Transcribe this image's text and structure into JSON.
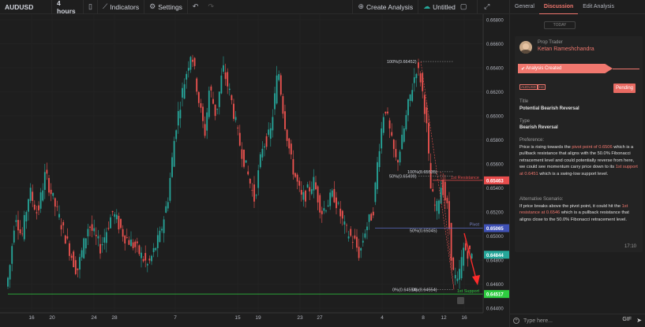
{
  "toolbar": {
    "symbol": "AUDUSD",
    "interval": "4 hours",
    "indicators": "Indicators",
    "settings": "Settings",
    "create_analysis": "Create Analysis",
    "untitled": "Untitled"
  },
  "chart_data": {
    "type": "candlestick",
    "price_axis": [
      "0.66800",
      "0.66600",
      "0.66400",
      "0.66200",
      "0.66000",
      "0.65800",
      "0.65600",
      "0.65400",
      "0.65200",
      "0.65000",
      "0.64800",
      "0.64600",
      "0.64400"
    ],
    "time_axis": [
      "16",
      "20",
      "24",
      "28",
      "7",
      "15",
      "19",
      "23",
      "27",
      "4",
      "8",
      "12",
      "16"
    ],
    "price_labels": [
      {
        "text": "0.65463",
        "color": "#e84c4c"
      },
      {
        "text": "0.65065",
        "color": "#3f51b5"
      },
      {
        "text": "0.64844",
        "color": "#26a69a"
      },
      {
        "text": "0.64517",
        "color": "#2ecc40"
      }
    ],
    "levels": [
      {
        "name": "1st Resistance",
        "price": 0.65463,
        "color": "#e84c4c"
      },
      {
        "name": "Pivot",
        "price": 0.65065,
        "color": "#5c6bc0"
      },
      {
        "name": "1st Support",
        "price": 0.64517,
        "color": "#2ecc40"
      }
    ],
    "fib_labels": {
      "f1_100": "100%(0.66452)",
      "f2_100": "100%(0.65535)",
      "f2_50": "50%(0.65499)",
      "f1_50": "50%(0.65045)",
      "f1_0": "0%(0.64554)",
      "f2_0": "0%(0.64554)"
    }
  },
  "panel": {
    "tabs": [
      "General",
      "Discussion",
      "Edit Analysis"
    ],
    "today": "TODAY",
    "role": "Prop Trader",
    "author": "Ketan Rameshchandra",
    "status_line": "Analysis Created",
    "tag_symbol": "AUDUSD",
    "tag_interval": "H4",
    "pending": "Pending",
    "title_label": "Title",
    "title_value": "Potential Bearish Reversal",
    "type_label": "Type",
    "type_value": "Bearish Reversal",
    "pref_label": "Preference:",
    "pref_1": "Price is rising towards the ",
    "pref_hl1": "pivot point of 0.6506",
    "pref_2": " which is a pullback resistance that aligns with the 50.0% Fibonacci retracement level and could potentially reverse from here, we could see momentum carry price down to its ",
    "pref_hl2": "1st support at 0.6451",
    "pref_3": " which is a swing-low support level.",
    "alt_label": "Alternative Scenario:",
    "alt_1": "If price breaks above the pivot point, it could hit the ",
    "alt_hl": "1st resistance at 0.6546",
    "alt_2": " which is a pullback resistance that aligns close to the 50.0% Fibonacci retracement level.",
    "time": "17:10",
    "reply_placeholder": "Type here...",
    "gif": "GIF"
  }
}
